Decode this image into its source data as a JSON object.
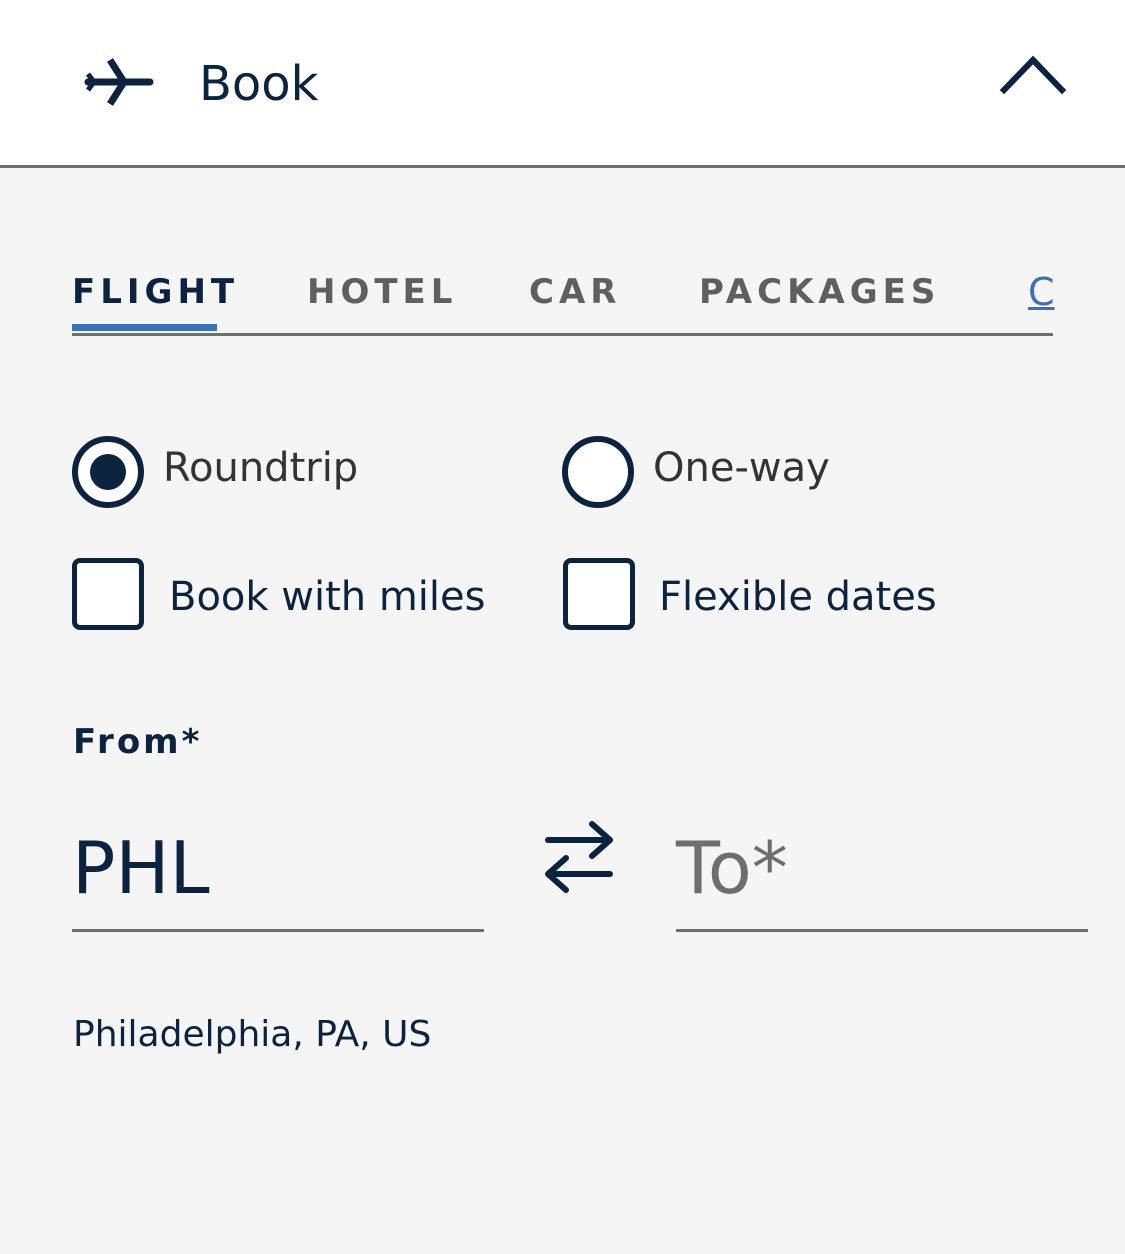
{
  "header": {
    "title": "Book",
    "icon": "plane-icon",
    "toggle_icon": "chevron-up-icon"
  },
  "tabs": [
    {
      "label": "FLIGHT",
      "active": true
    },
    {
      "label": "HOTEL",
      "active": false
    },
    {
      "label": "CAR",
      "active": false
    },
    {
      "label": "PACKAGES",
      "active": false
    },
    {
      "label": "C",
      "active": false
    }
  ],
  "trip_type": {
    "options": [
      {
        "label": "Roundtrip",
        "selected": true
      },
      {
        "label": "One-way",
        "selected": false
      }
    ]
  },
  "options": {
    "book_with_miles": {
      "label": "Book with miles",
      "checked": false
    },
    "flexible_dates": {
      "label": "Flexible dates",
      "checked": false
    }
  },
  "route": {
    "from_label": "From*",
    "from_value": "PHL",
    "from_city": "Philadelphia, PA, US",
    "to_placeholder": "To*",
    "swap_icon": "swap-arrows-icon"
  },
  "colors": {
    "brand_navy": "#0c2340",
    "accent_blue": "#3c6fb5",
    "panel_bg": "#f5f5f5",
    "header_bg": "#ffffff"
  }
}
